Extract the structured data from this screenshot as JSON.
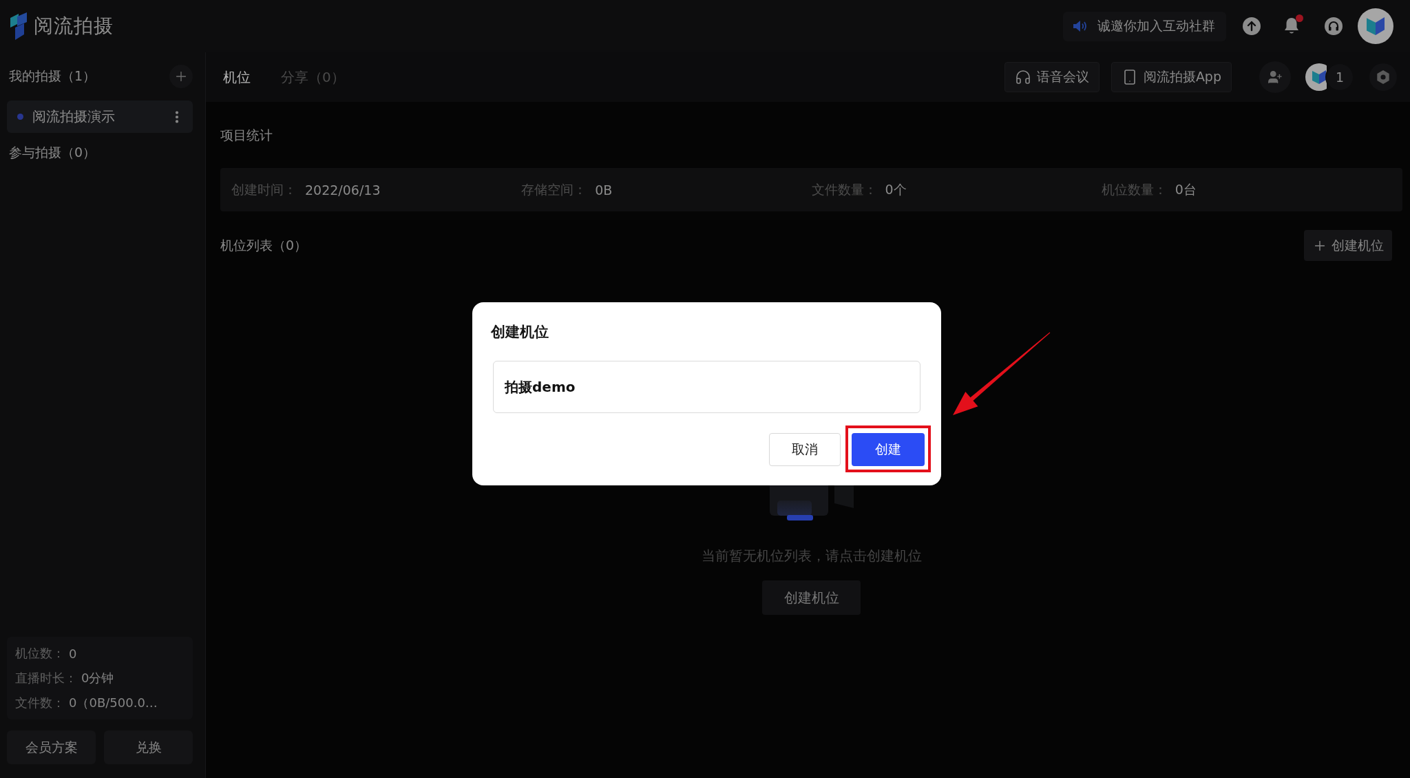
{
  "logo": {
    "text": "阅流拍摄"
  },
  "top_bar": {
    "banner": "诚邀你加入互动社群",
    "notifications_unread": true
  },
  "sidebar": {
    "my_title": "我的拍摄（1）",
    "my_items": [
      {
        "label": "阅流拍摄演示",
        "selected": true
      }
    ],
    "joined_title": "参与拍摄（0）",
    "usage": [
      {
        "label": "机位数：",
        "value": "0"
      },
      {
        "label": "直播时长：",
        "value": "0分钟"
      },
      {
        "label": "文件数：",
        "value": "0（0B/500.0…"
      }
    ],
    "buttons": [
      "会员方案",
      "兑换"
    ]
  },
  "header": {
    "tabs": [
      {
        "label": "机位",
        "selected": true
      },
      {
        "label": "分享（0）",
        "selected": false
      }
    ],
    "actions": [
      {
        "kind": "headset",
        "label": "语音会议"
      },
      {
        "kind": "phone",
        "label": "阅流拍摄App"
      }
    ],
    "member_count": "1"
  },
  "stats": {
    "title": "项目统计",
    "items": [
      {
        "label": "创建时间：",
        "value": "2022/06/13"
      },
      {
        "label": "存储空间：",
        "value": "0B"
      },
      {
        "label": "文件数量：",
        "value": "0个"
      },
      {
        "label": "机位数量：",
        "value": "0台"
      }
    ]
  },
  "camera_list": {
    "title": "机位列表（0）",
    "create_button": "创建机位",
    "empty_text": "当前暂无机位列表，请点击创建机位",
    "empty_button": "创建机位"
  },
  "dialog": {
    "title": "创建机位",
    "input_value": "拍摄demo",
    "buttons": [
      {
        "kind": "secondary",
        "label": "取消",
        "highlighted": false
      },
      {
        "kind": "primary",
        "label": "创建",
        "highlighted": true
      }
    ]
  }
}
